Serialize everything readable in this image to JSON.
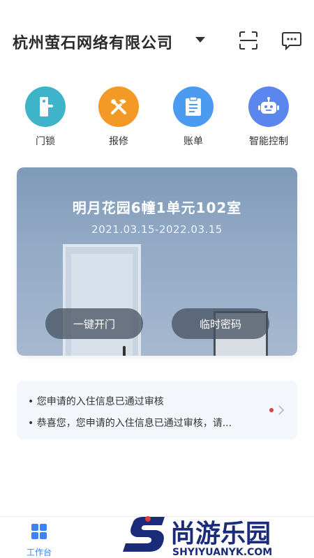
{
  "header": {
    "company_name": "杭州萤石网络有限公司",
    "dropdown_icon": "caret-down-icon",
    "scan_icon": "scan-icon",
    "message_icon": "message-icon"
  },
  "actions": [
    {
      "label": "门锁",
      "icon": "door-lock-icon",
      "color": "#3fb3c9"
    },
    {
      "label": "报修",
      "icon": "repair-icon",
      "color": "#f39a26"
    },
    {
      "label": "账单",
      "icon": "bill-icon",
      "color": "#4b9cf0"
    },
    {
      "label": "智能控制",
      "icon": "robot-icon",
      "color": "#5b86ee"
    }
  ],
  "room_card": {
    "title": "明月花园6幢1单元102室",
    "period": "2021.03.15-2022.03.15",
    "unlock_button": "一键开门",
    "temp_password_button": "临时密码"
  },
  "notices": {
    "items": [
      "• 您申请的入住信息已通过审核",
      "• 恭喜您，您申请的入住信息已通过审核，请..."
    ],
    "unread_color": "#e53a3a"
  },
  "tabbar": {
    "active_tab_label": "工作台",
    "active_color": "#3b82f6"
  },
  "watermark": {
    "text": "尚游乐园",
    "url": "SHYIYUANYK.COM"
  }
}
